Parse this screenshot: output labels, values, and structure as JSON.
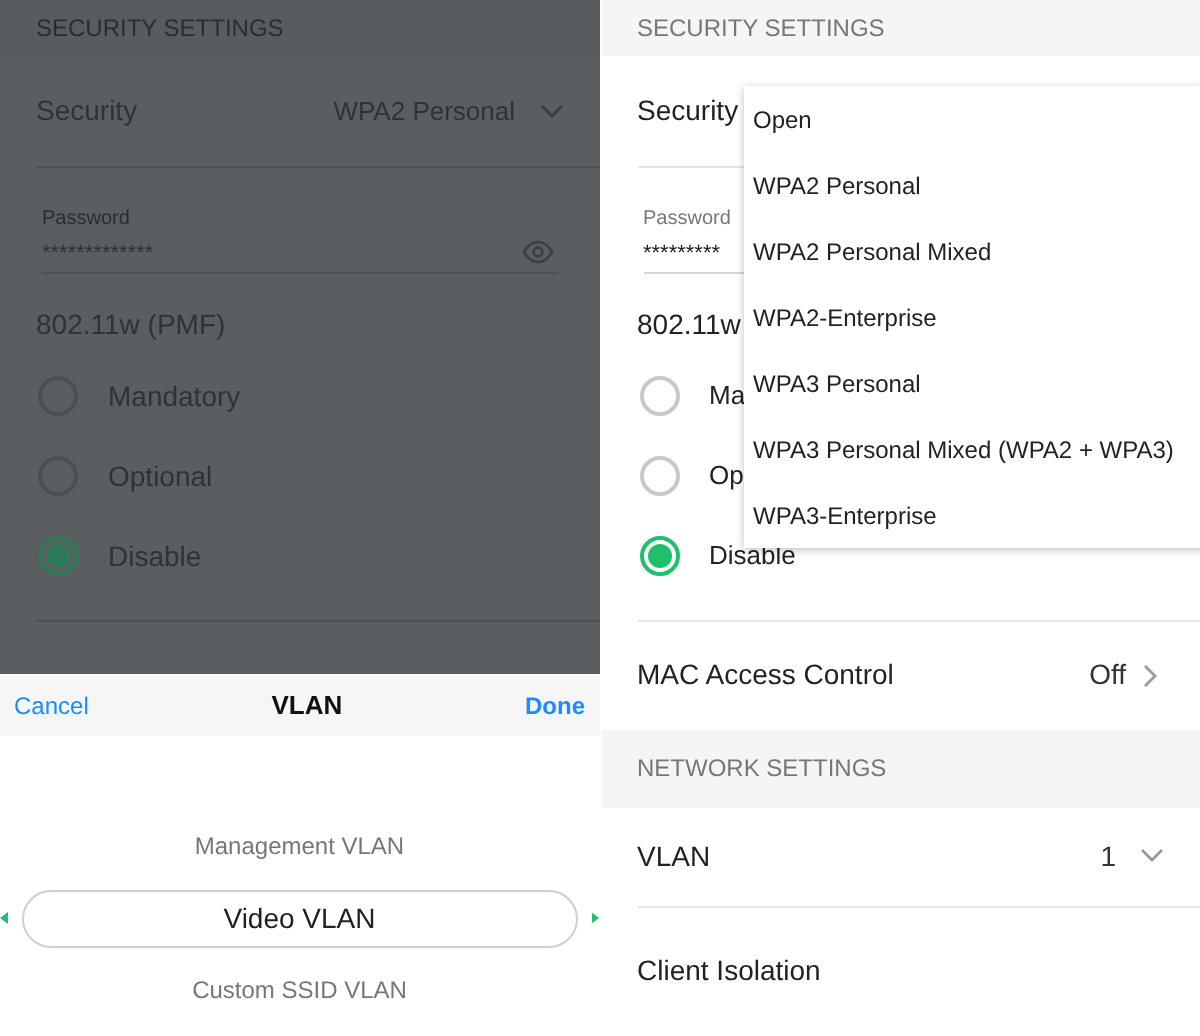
{
  "left_screen": {
    "section_header": "SECURITY SETTINGS",
    "security": {
      "label": "Security",
      "value": "WPA2 Personal"
    },
    "password": {
      "label": "Password",
      "value": "*************"
    },
    "pmf": {
      "title": "802.11w (PMF)",
      "options": [
        {
          "label": "Mandatory",
          "selected": false
        },
        {
          "label": "Optional",
          "selected": false
        },
        {
          "label": "Disable",
          "selected": true
        }
      ]
    },
    "picker": {
      "cancel": "Cancel",
      "title": "VLAN",
      "done": "Done",
      "options": [
        {
          "label": "Management VLAN",
          "selected": false
        },
        {
          "label": "Video VLAN",
          "selected": true
        },
        {
          "label": "Custom SSID VLAN",
          "selected": false
        }
      ]
    }
  },
  "right_screen": {
    "section_header": "SECURITY SETTINGS",
    "security": {
      "label": "Security"
    },
    "password": {
      "label": "Password",
      "value": "*********"
    },
    "pmf": {
      "title": "802.11w",
      "options": [
        {
          "label": "Ma",
          "selected": false
        },
        {
          "label": "Op",
          "selected": false
        },
        {
          "label": "Disable",
          "selected": true
        }
      ]
    },
    "dropdown": {
      "options": [
        {
          "label": "Open"
        },
        {
          "label": "WPA2 Personal"
        },
        {
          "label": "WPA2 Personal Mixed"
        },
        {
          "label": "WPA2-Enterprise"
        },
        {
          "label": "WPA3 Personal"
        },
        {
          "label": "WPA3 Personal Mixed (WPA2 + WPA3)"
        },
        {
          "label": "WPA3-Enterprise"
        }
      ]
    },
    "mac_access": {
      "label": "MAC Access Control",
      "value": "Off"
    },
    "network_header": "NETWORK SETTINGS",
    "vlan": {
      "label": "VLAN",
      "value": "1"
    },
    "client_isolation": {
      "label": "Client Isolation"
    }
  }
}
